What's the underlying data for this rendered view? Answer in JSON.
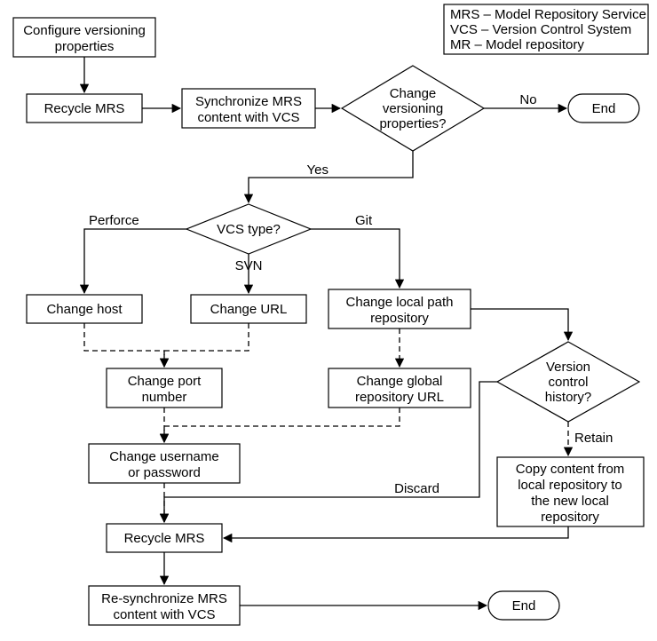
{
  "legend": {
    "l1": "MRS – Model Repository Service",
    "l2": "VCS – Version Control System",
    "l3": "MR – Model repository"
  },
  "nodes": {
    "configure_l1": "Configure versioning",
    "configure_l2": "properties",
    "recycle1": "Recycle MRS",
    "sync_l1": "Synchronize MRS",
    "sync_l2": "content with VCS",
    "qChange_l1": "Change",
    "qChange_l2": "versioning",
    "qChange_l3": "properties?",
    "end1": "End",
    "vcsType": "VCS type?",
    "changeHost": "Change host",
    "changeURL": "Change URL",
    "changeLocal_l1": "Change local path",
    "changeLocal_l2": "repository",
    "changePort_l1": "Change port",
    "changePort_l2": "number",
    "changeGlobal_l1": "Change global",
    "changeGlobal_l2": "repository URL",
    "qHistory_l1": "Version",
    "qHistory_l2": "control",
    "qHistory_l3": "history?",
    "changeUser_l1": "Change username",
    "changeUser_l2": "or password",
    "copy_l1": "Copy content from",
    "copy_l2": "local repository to",
    "copy_l3": "the new local",
    "copy_l4": "repository",
    "recycle2": "Recycle MRS",
    "resync_l1": "Re-synchronize MRS",
    "resync_l2": "content with VCS",
    "end2": "End"
  },
  "edges": {
    "no": "No",
    "yes": "Yes",
    "perforce": "Perforce",
    "svn": "SVN",
    "git": "Git",
    "retain": "Retain",
    "discard": "Discard"
  }
}
